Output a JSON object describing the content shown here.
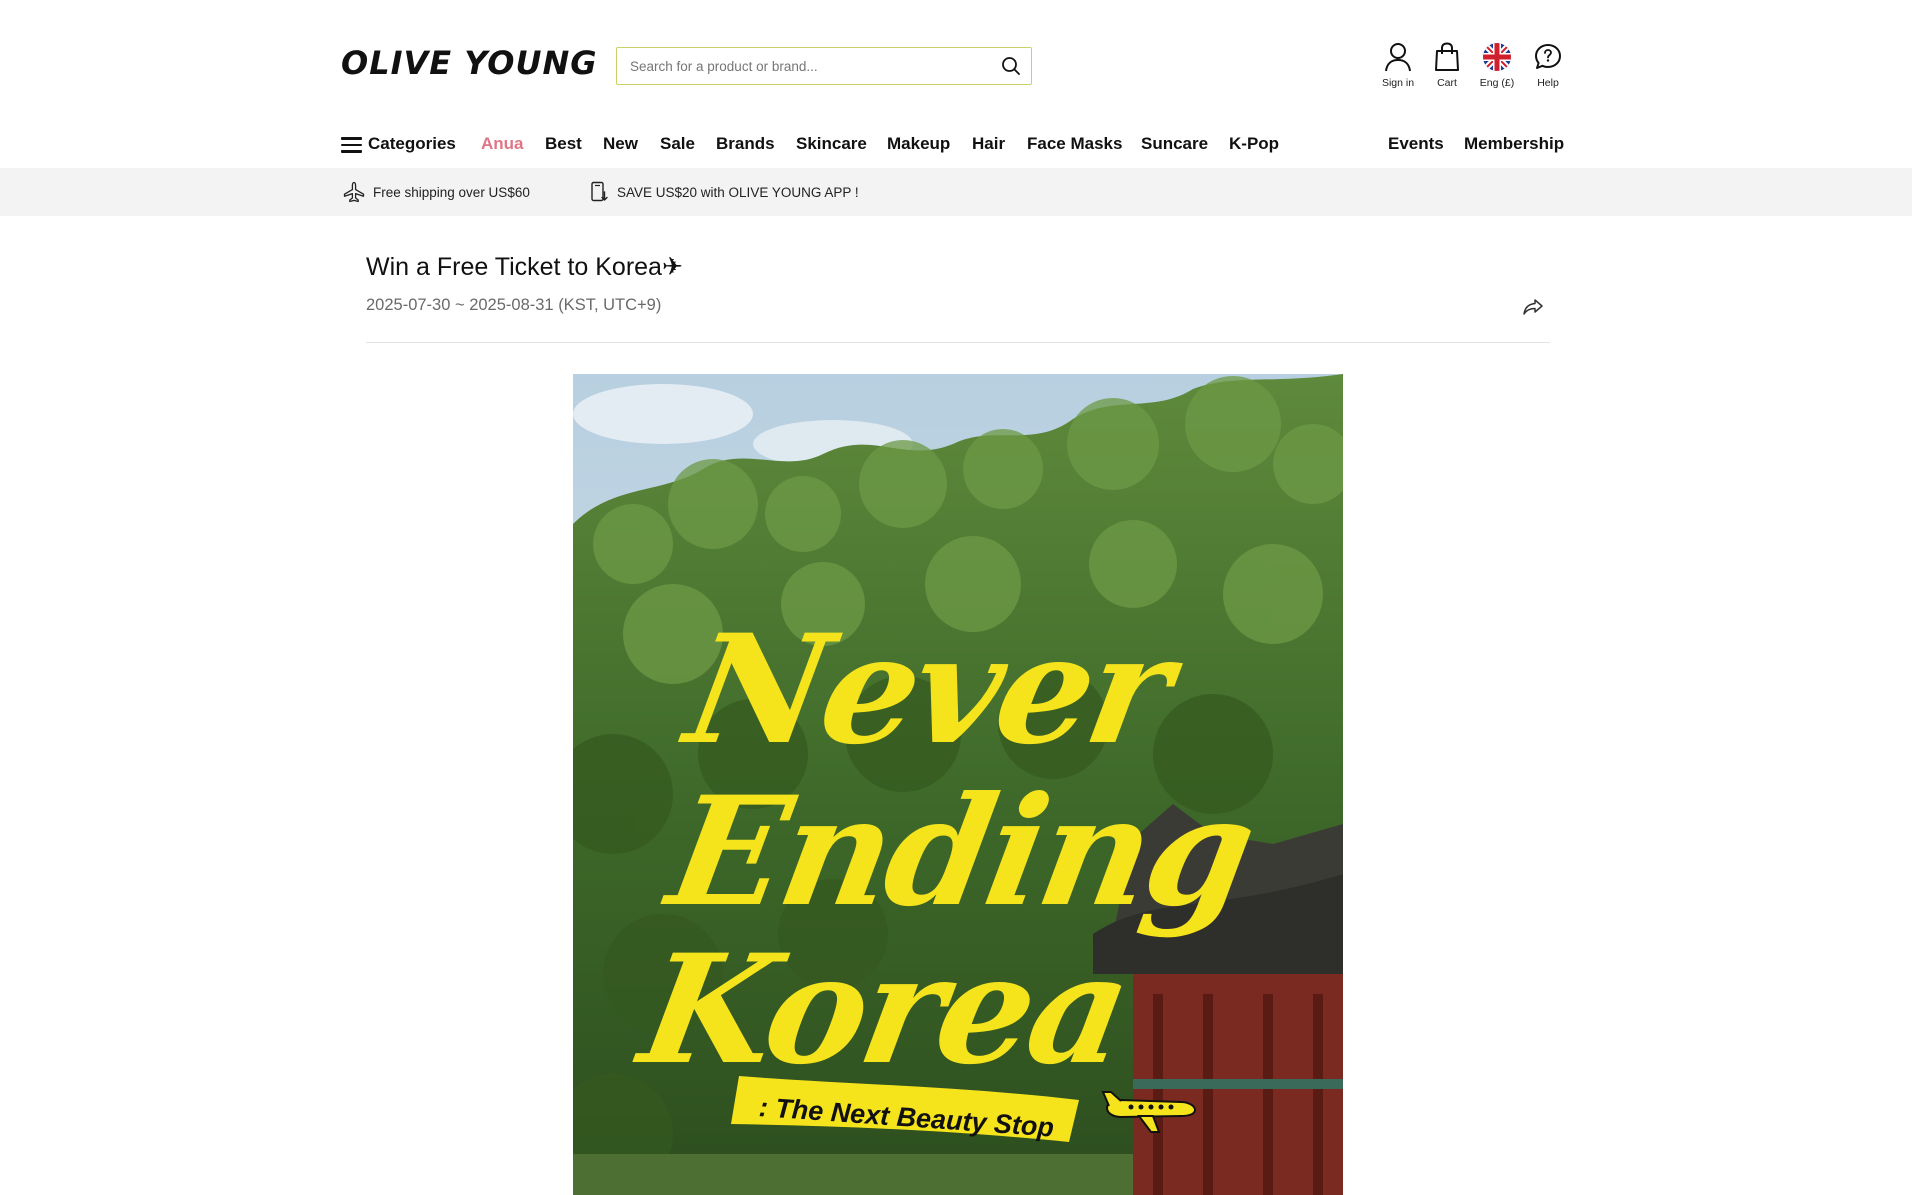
{
  "header": {
    "logo": "OLIVE YOUNG",
    "search": {
      "placeholder": "Search for a product or brand..."
    },
    "utilities": [
      {
        "label": "Sign in",
        "icon": "user-icon"
      },
      {
        "label": "Cart",
        "icon": "bag-icon"
      },
      {
        "label": "Eng (£)",
        "icon": "uk-flag-icon"
      },
      {
        "label": "Help",
        "icon": "help-chat-icon"
      }
    ]
  },
  "nav": {
    "categories": "Categories",
    "items": [
      "Anua",
      "Best",
      "New",
      "Sale",
      "Brands",
      "Skincare",
      "Makeup",
      "Hair",
      "Face Masks",
      "Suncare",
      "K-Pop"
    ],
    "right_items": [
      "Events",
      "Membership"
    ],
    "accent_color": "#e07586"
  },
  "promo": {
    "shipping": "Free shipping over US$60",
    "app": "SAVE US$20 with OLIVE YOUNG APP !"
  },
  "event": {
    "title": "Win a Free Ticket to Korea✈",
    "dates": "2025-07-30 ~ 2025-08-31 (KST, UTC+9)"
  },
  "banner": {
    "line1": "Never",
    "line2": "Ending",
    "line3": "Korea",
    "tagline": ": The Next Beauty Stop",
    "text_color": "#f5e31c"
  }
}
